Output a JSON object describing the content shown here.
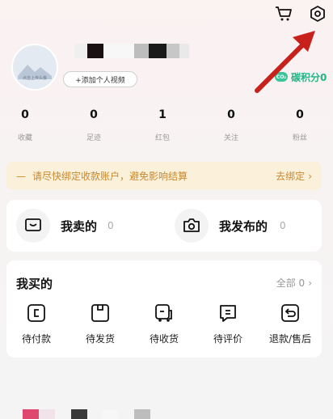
{
  "header": {
    "cart_icon": "cart-icon",
    "settings_icon": "settings-icon"
  },
  "profile": {
    "avatar_caption": "点击上传头像",
    "add_video_label": "+添加个人视频",
    "carbon_points_label": "碳积分0",
    "carbon_icon_text": "CO₂"
  },
  "stats": [
    {
      "value": "0",
      "label": "收藏"
    },
    {
      "value": "0",
      "label": "足迹"
    },
    {
      "value": "1",
      "label": "红包"
    },
    {
      "value": "0",
      "label": "关注"
    },
    {
      "value": "0",
      "label": "粉丝"
    }
  ],
  "notice": {
    "text": "请尽快绑定收款账户，避免影响结算",
    "action": "去绑定"
  },
  "selling": {
    "sold": {
      "label": "我卖的",
      "count": "0"
    },
    "published": {
      "label": "我发布的",
      "count": "0"
    }
  },
  "bought": {
    "title": "我买的",
    "all_label": "全部 0",
    "orders": [
      {
        "label": "待付款",
        "icon": "pending-payment-icon"
      },
      {
        "label": "待发货",
        "icon": "pending-shipment-icon"
      },
      {
        "label": "待收货",
        "icon": "pending-receipt-icon"
      },
      {
        "label": "待评价",
        "icon": "pending-review-icon"
      },
      {
        "label": "退款/售后",
        "icon": "refund-icon"
      }
    ]
  },
  "colors": {
    "accent_green": "#22b586",
    "notice_text": "#c9892f",
    "notice_bg": "#fbf0da",
    "arrow_red": "#c8211c"
  }
}
